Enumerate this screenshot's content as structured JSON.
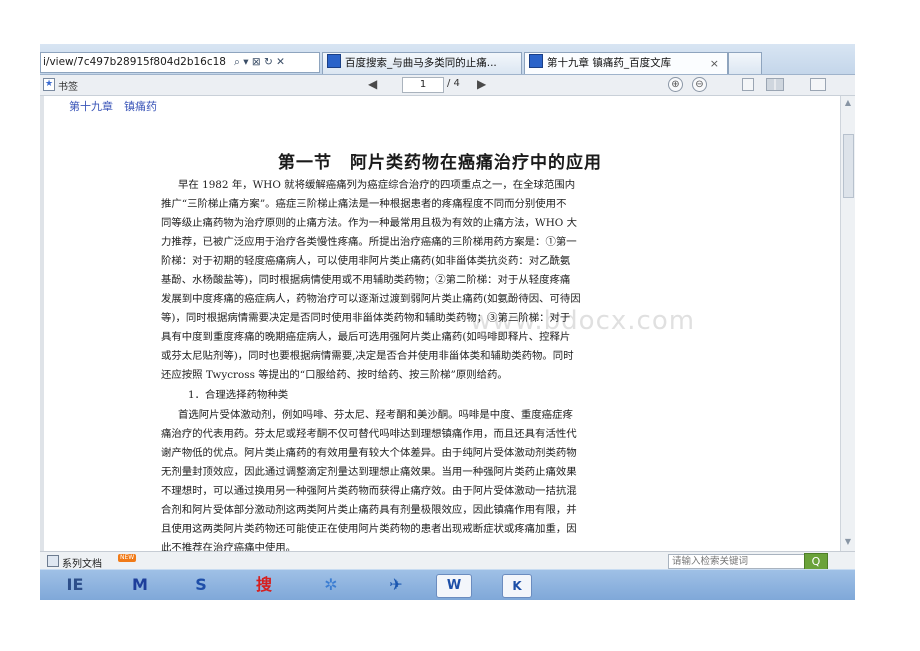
{
  "browser": {
    "address": "i/view/7c497b28915f804d2b16c18",
    "address_icons": "⌕ ▾ ⊠ ↻ ✕",
    "tabs": [
      {
        "label": "百度搜索_与曲马多类同的止痛..."
      },
      {
        "label": "第十九章 镇痛药_百度文库",
        "close": "×"
      }
    ]
  },
  "toolbar": {
    "bookmark_label": "书签",
    "bookmark_icon": "bookmark-icon",
    "page_current": "1",
    "page_total": "/ 4",
    "zoom_in": "⊕",
    "zoom_out": "⊖"
  },
  "document": {
    "chapter": "第十九章　镇痛药",
    "title": "第一节　阿片类药物在癌痛治疗中的应用",
    "watermark": "www.bdocx.com",
    "lines": [
      "早在 1982 年，WHO 就将缓解癌痛列为癌症综合治疗的四项重点之一，在全球范围内",
      "推广“三阶梯止痛方案”。癌症三阶梯止痛法是一种根据患者的疼痛程度不同而分别使用不",
      "同等级止痛药物为治疗原则的止痛方法。作为一种最常用且极为有效的止痛方法，WHO 大",
      "力推荐，已被广泛应用于治疗各类慢性疼痛。所提出治疗癌痛的三阶梯用药方案是：①第一",
      "阶梯：对于初期的轻度癌痛病人，可以使用非阿片类止痛药(如非甾体类抗炎药：对乙酰氨",
      "基酚、水杨酸盐等)，同时根据病情使用或不用辅助类药物；②第二阶梯：对于从轻度疼痛",
      "发展到中度疼痛的癌症病人，药物治疗可以逐渐过渡到弱阿片类止痛药(如氨酚待因、可待因",
      "等)，同时根据病情需要决定是否同时使用非甾体类药物和辅助类药物；③第三阶梯：对于",
      "具有中度到重度疼痛的晚期癌症病人，最后可选用强阿片类止痛药(如吗啡即释片、控释片",
      "或芬太尼贴剂等)，同时也要根据病情需要,决定是否合并使用非甾体类和辅助类药物。同时",
      "还应按照 Twycross 等提出的“口服给药、按时给药、按三阶梯”原则给药。",
      "1．合理选择药物种类",
      "首选阿片受体激动剂，例如吗啡、芬太尼、羟考酮和美沙酮。吗啡是中度、重度癌症疼",
      "痛治疗的代表用药。芬太尼或羟考酮不仅可替代吗啡达到理想镇痛作用，而且还具有活性代",
      "谢产物低的优点。阿片类止痛药的有效用量有较大个体差异。由于纯阿片受体激动剂类药物",
      "无剂量封顶效应，因此通过调整滴定剂量达到理想止痛效果。当用一种强阿片类药止痛效果",
      "不理想时，可以通过换用另一种强阿片类药物而获得止痛疗效。由于阿片受体激动一拮抗混",
      "合剂和阿片受体部分激动剂这两类阿片类止痛药具有剂量极限效应，因此镇痛作用有限，并",
      "且使用这两类阿片类药物还可能使正在使用阿片类药物的患者出现戒断症状或疼痛加重，因",
      "此不推荐在治疗癌痛中使用。"
    ]
  },
  "statusbar": {
    "series_label": "系列文档",
    "badge": "NEW",
    "search_placeholder": "请输入检索关键词",
    "search_button": "Q"
  },
  "taskbar": {
    "items": [
      "IE",
      "M",
      "S",
      "搜",
      "✲",
      "✈",
      "W",
      "K"
    ]
  }
}
